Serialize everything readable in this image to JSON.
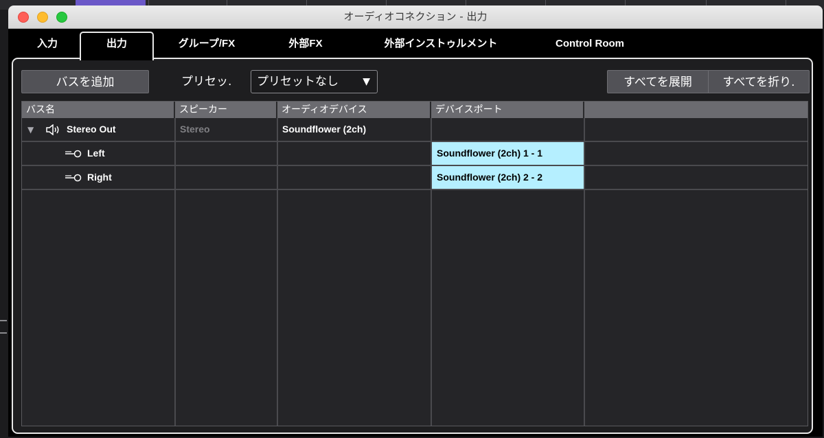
{
  "window": {
    "title": "オーディオコネクション - 出力"
  },
  "tabs": [
    {
      "label": "入力"
    },
    {
      "label": "出力"
    },
    {
      "label": "グループ/FX"
    },
    {
      "label": "外部FX"
    },
    {
      "label": "外部インストゥルメント"
    },
    {
      "label": "Control Room"
    }
  ],
  "active_tab": "出力",
  "toolbar": {
    "add_bus_label": "バスを追加",
    "preset_label": "プリセッ.",
    "preset_value": "プリセットなし",
    "dropdown_arrow": "▼",
    "expand_all_label": "すべてを展開",
    "collapse_all_label": "すべてを折り."
  },
  "table": {
    "columns": [
      "バス名",
      "スピーカー",
      "オーディオデバイス",
      "デバイスポート",
      ""
    ],
    "rows": [
      {
        "name": "Stereo Out",
        "speaker": "Stereo",
        "device": "Soundflower (2ch)",
        "port": "",
        "expanded": true,
        "icon": "speaker-icon"
      },
      {
        "name": "Left",
        "speaker": "",
        "device": "",
        "port": "Soundflower (2ch) 1 - 1",
        "icon": "plug-icon"
      },
      {
        "name": "Right",
        "speaker": "",
        "device": "",
        "port": "Soundflower (2ch) 2 - 2",
        "icon": "plug-icon"
      }
    ],
    "expand_glyph": "▼"
  },
  "colors": {
    "port_highlight": "#b5efff",
    "window_bg": "#000000",
    "button_bg": "#525257"
  }
}
